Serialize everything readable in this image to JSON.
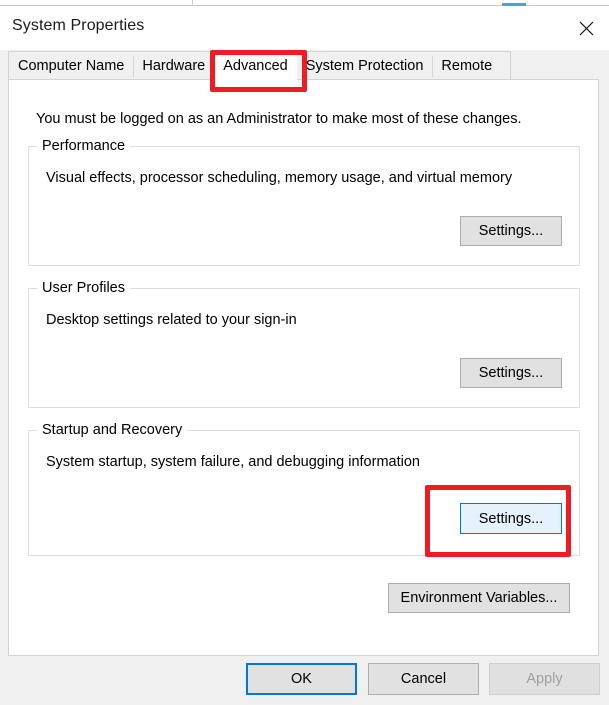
{
  "window": {
    "title": "System Properties",
    "close_icon": "close-icon"
  },
  "tabs": [
    {
      "label": "Computer Name",
      "active": false
    },
    {
      "label": "Hardware",
      "active": false
    },
    {
      "label": "Advanced",
      "active": true
    },
    {
      "label": "System Protection",
      "active": false
    },
    {
      "label": "Remote",
      "active": false
    }
  ],
  "main": {
    "intro": "You must be logged on as an Administrator to make most of these changes.",
    "groups": [
      {
        "legend": "Performance",
        "description": "Visual effects, processor scheduling, memory usage, and virtual memory",
        "button_label": "Settings...",
        "button_state": "normal"
      },
      {
        "legend": "User Profiles",
        "description": "Desktop settings related to your sign-in",
        "button_label": "Settings...",
        "button_state": "normal"
      },
      {
        "legend": "Startup and Recovery",
        "description": "System startup, system failure, and debugging information",
        "button_label": "Settings...",
        "button_state": "hovered"
      }
    ],
    "environment_variables_label": "Environment Variables..."
  },
  "footer": {
    "ok_label": "OK",
    "cancel_label": "Cancel",
    "apply_label": "Apply",
    "apply_state": "disabled"
  },
  "annotations": {
    "accent_color": "#ee1c25",
    "highlight_tab": "Advanced",
    "highlight_button": "Startup and Recovery Settings..."
  }
}
